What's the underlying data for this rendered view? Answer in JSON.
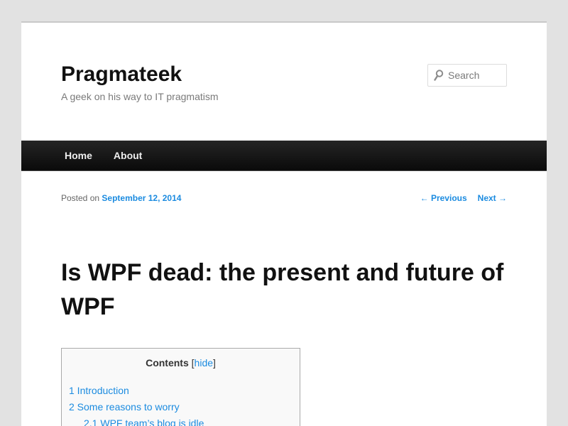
{
  "header": {
    "site_title": "Pragmateek",
    "site_description": "A geek on his way to IT pragmatism"
  },
  "search": {
    "placeholder": "Search",
    "icon": "search-icon"
  },
  "nav": {
    "items": [
      {
        "label": "Home"
      },
      {
        "label": "About"
      }
    ]
  },
  "entry": {
    "posted_on_label": "Posted on",
    "date": "September 12, 2014",
    "previous_label": "← Previous",
    "next_label": "Next →",
    "title": "Is WPF dead: the present and future of WPF"
  },
  "toc": {
    "title": "Contents",
    "bracket_open": "[",
    "hide_label": "hide",
    "bracket_close": "]",
    "items": [
      {
        "label": "1 Introduction"
      },
      {
        "label": "2 Some reasons to worry"
      },
      {
        "label": "2.1 WPF team’s blog is idle"
      }
    ]
  },
  "colors": {
    "link": "#1b8be0",
    "nav_background": "#111111",
    "page_background": "#e2e2e2"
  }
}
